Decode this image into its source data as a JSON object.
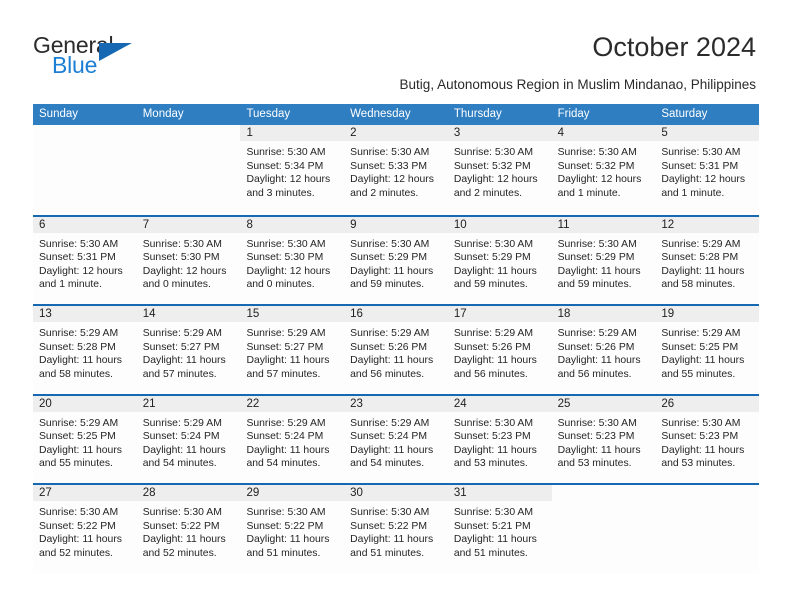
{
  "brand": {
    "name_part1": "General",
    "name_part2": "Blue",
    "triangle_color": "#1668b3",
    "blue_color": "#1c7fd4"
  },
  "header": {
    "title": "October 2024",
    "subtitle": "Butig, Autonomous Region in Muslim Mindanao, Philippines",
    "accent_color": "#2f7ec1",
    "separator_color": "#1668b3"
  },
  "weekday_headers": [
    "Sunday",
    "Monday",
    "Tuesday",
    "Wednesday",
    "Thursday",
    "Friday",
    "Saturday"
  ],
  "weeks": [
    [
      {
        "day": "",
        "sunrise": "",
        "sunset": "",
        "daylight": ""
      },
      {
        "day": "",
        "sunrise": "",
        "sunset": "",
        "daylight": ""
      },
      {
        "day": "1",
        "sunrise": "Sunrise: 5:30 AM",
        "sunset": "Sunset: 5:34 PM",
        "daylight": "Daylight: 12 hours and 3 minutes."
      },
      {
        "day": "2",
        "sunrise": "Sunrise: 5:30 AM",
        "sunset": "Sunset: 5:33 PM",
        "daylight": "Daylight: 12 hours and 2 minutes."
      },
      {
        "day": "3",
        "sunrise": "Sunrise: 5:30 AM",
        "sunset": "Sunset: 5:32 PM",
        "daylight": "Daylight: 12 hours and 2 minutes."
      },
      {
        "day": "4",
        "sunrise": "Sunrise: 5:30 AM",
        "sunset": "Sunset: 5:32 PM",
        "daylight": "Daylight: 12 hours and 1 minute."
      },
      {
        "day": "5",
        "sunrise": "Sunrise: 5:30 AM",
        "sunset": "Sunset: 5:31 PM",
        "daylight": "Daylight: 12 hours and 1 minute."
      }
    ],
    [
      {
        "day": "6",
        "sunrise": "Sunrise: 5:30 AM",
        "sunset": "Sunset: 5:31 PM",
        "daylight": "Daylight: 12 hours and 1 minute."
      },
      {
        "day": "7",
        "sunrise": "Sunrise: 5:30 AM",
        "sunset": "Sunset: 5:30 PM",
        "daylight": "Daylight: 12 hours and 0 minutes."
      },
      {
        "day": "8",
        "sunrise": "Sunrise: 5:30 AM",
        "sunset": "Sunset: 5:30 PM",
        "daylight": "Daylight: 12 hours and 0 minutes."
      },
      {
        "day": "9",
        "sunrise": "Sunrise: 5:30 AM",
        "sunset": "Sunset: 5:29 PM",
        "daylight": "Daylight: 11 hours and 59 minutes."
      },
      {
        "day": "10",
        "sunrise": "Sunrise: 5:30 AM",
        "sunset": "Sunset: 5:29 PM",
        "daylight": "Daylight: 11 hours and 59 minutes."
      },
      {
        "day": "11",
        "sunrise": "Sunrise: 5:30 AM",
        "sunset": "Sunset: 5:29 PM",
        "daylight": "Daylight: 11 hours and 59 minutes."
      },
      {
        "day": "12",
        "sunrise": "Sunrise: 5:29 AM",
        "sunset": "Sunset: 5:28 PM",
        "daylight": "Daylight: 11 hours and 58 minutes."
      }
    ],
    [
      {
        "day": "13",
        "sunrise": "Sunrise: 5:29 AM",
        "sunset": "Sunset: 5:28 PM",
        "daylight": "Daylight: 11 hours and 58 minutes."
      },
      {
        "day": "14",
        "sunrise": "Sunrise: 5:29 AM",
        "sunset": "Sunset: 5:27 PM",
        "daylight": "Daylight: 11 hours and 57 minutes."
      },
      {
        "day": "15",
        "sunrise": "Sunrise: 5:29 AM",
        "sunset": "Sunset: 5:27 PM",
        "daylight": "Daylight: 11 hours and 57 minutes."
      },
      {
        "day": "16",
        "sunrise": "Sunrise: 5:29 AM",
        "sunset": "Sunset: 5:26 PM",
        "daylight": "Daylight: 11 hours and 56 minutes."
      },
      {
        "day": "17",
        "sunrise": "Sunrise: 5:29 AM",
        "sunset": "Sunset: 5:26 PM",
        "daylight": "Daylight: 11 hours and 56 minutes."
      },
      {
        "day": "18",
        "sunrise": "Sunrise: 5:29 AM",
        "sunset": "Sunset: 5:26 PM",
        "daylight": "Daylight: 11 hours and 56 minutes."
      },
      {
        "day": "19",
        "sunrise": "Sunrise: 5:29 AM",
        "sunset": "Sunset: 5:25 PM",
        "daylight": "Daylight: 11 hours and 55 minutes."
      }
    ],
    [
      {
        "day": "20",
        "sunrise": "Sunrise: 5:29 AM",
        "sunset": "Sunset: 5:25 PM",
        "daylight": "Daylight: 11 hours and 55 minutes."
      },
      {
        "day": "21",
        "sunrise": "Sunrise: 5:29 AM",
        "sunset": "Sunset: 5:24 PM",
        "daylight": "Daylight: 11 hours and 54 minutes."
      },
      {
        "day": "22",
        "sunrise": "Sunrise: 5:29 AM",
        "sunset": "Sunset: 5:24 PM",
        "daylight": "Daylight: 11 hours and 54 minutes."
      },
      {
        "day": "23",
        "sunrise": "Sunrise: 5:29 AM",
        "sunset": "Sunset: 5:24 PM",
        "daylight": "Daylight: 11 hours and 54 minutes."
      },
      {
        "day": "24",
        "sunrise": "Sunrise: 5:30 AM",
        "sunset": "Sunset: 5:23 PM",
        "daylight": "Daylight: 11 hours and 53 minutes."
      },
      {
        "day": "25",
        "sunrise": "Sunrise: 5:30 AM",
        "sunset": "Sunset: 5:23 PM",
        "daylight": "Daylight: 11 hours and 53 minutes."
      },
      {
        "day": "26",
        "sunrise": "Sunrise: 5:30 AM",
        "sunset": "Sunset: 5:23 PM",
        "daylight": "Daylight: 11 hours and 53 minutes."
      }
    ],
    [
      {
        "day": "27",
        "sunrise": "Sunrise: 5:30 AM",
        "sunset": "Sunset: 5:22 PM",
        "daylight": "Daylight: 11 hours and 52 minutes."
      },
      {
        "day": "28",
        "sunrise": "Sunrise: 5:30 AM",
        "sunset": "Sunset: 5:22 PM",
        "daylight": "Daylight: 11 hours and 52 minutes."
      },
      {
        "day": "29",
        "sunrise": "Sunrise: 5:30 AM",
        "sunset": "Sunset: 5:22 PM",
        "daylight": "Daylight: 11 hours and 51 minutes."
      },
      {
        "day": "30",
        "sunrise": "Sunrise: 5:30 AM",
        "sunset": "Sunset: 5:22 PM",
        "daylight": "Daylight: 11 hours and 51 minutes."
      },
      {
        "day": "31",
        "sunrise": "Sunrise: 5:30 AM",
        "sunset": "Sunset: 5:21 PM",
        "daylight": "Daylight: 11 hours and 51 minutes."
      },
      {
        "day": "",
        "sunrise": "",
        "sunset": "",
        "daylight": ""
      },
      {
        "day": "",
        "sunrise": "",
        "sunset": "",
        "daylight": ""
      }
    ]
  ]
}
